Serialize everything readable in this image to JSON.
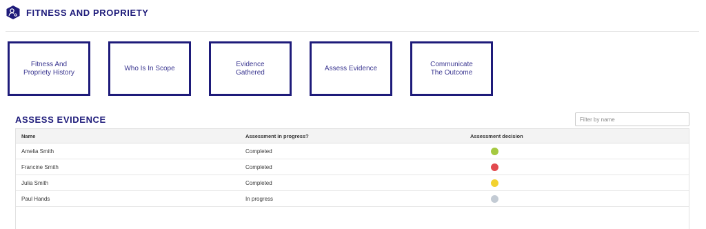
{
  "header": {
    "title": "FITNESS AND PROPRIETY",
    "icon": "person-settings-icon",
    "accent_color": "#1e1b7a"
  },
  "steps": [
    {
      "label": "Fitness And\nPropriety History"
    },
    {
      "label": "Who Is In Scope"
    },
    {
      "label": "Evidence\nGathered"
    },
    {
      "label": "Assess Evidence"
    },
    {
      "label": "Communicate\nThe Outcome"
    }
  ],
  "section": {
    "title": "ASSESS EVIDENCE",
    "filter_placeholder": "Filter by name",
    "filter_value": ""
  },
  "table": {
    "columns": [
      "Name",
      "Assessment in progress?",
      "Assessment decision"
    ],
    "rows": [
      {
        "name": "Amelia Smith",
        "progress": "Completed",
        "decision_color": "#a5c940"
      },
      {
        "name": "Francine Smith",
        "progress": "Completed",
        "decision_color": "#e24a4f"
      },
      {
        "name": "Julia Smith",
        "progress": "Completed",
        "decision_color": "#f2d230"
      },
      {
        "name": "Paul Hands",
        "progress": "In progress",
        "decision_color": "#c3cbd4"
      }
    ]
  }
}
